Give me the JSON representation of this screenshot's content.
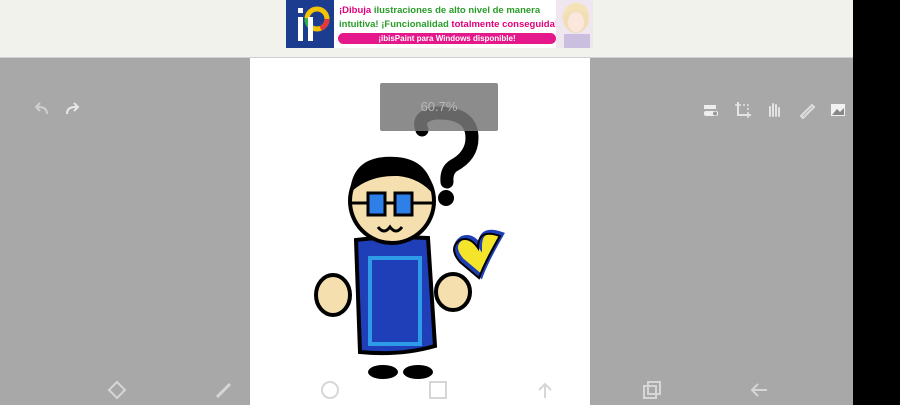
{
  "ad": {
    "logo_text": "iP",
    "headline_part1": "¡Dibuja",
    "headline_part2": " ilustraciones de alto nivel de manera",
    "line2_part1": "intuitiva! ¡Funcionalidad",
    "line2_part2": " totalmente conseguida!",
    "cta": "¡ibisPaint para Windows disponible!"
  },
  "zoom": {
    "label": "60.7%",
    "value_percent": 60.7
  },
  "toolbar_top": {
    "left": [
      {
        "name": "undo-icon"
      },
      {
        "name": "redo-icon"
      }
    ],
    "right": [
      {
        "name": "toggle-icon"
      },
      {
        "name": "crop-icon"
      },
      {
        "name": "hand-icon"
      },
      {
        "name": "pencil-icon"
      },
      {
        "name": "image-icon"
      }
    ]
  },
  "toolbar_bottom": [
    {
      "name": "transform-icon"
    },
    {
      "name": "brush-icon"
    },
    {
      "name": "circle-icon"
    },
    {
      "name": "square-icon"
    },
    {
      "name": "upload-icon"
    },
    {
      "name": "layers-icon"
    },
    {
      "name": "back-arrow-icon"
    }
  ],
  "colors": {
    "app_background": "#a8a8a8",
    "canvas": "#ffffff",
    "cape_blue": "#1f3fb8",
    "cape_light_blue": "#2e9be8",
    "skin": "#f5dfae",
    "heart_yellow": "#f5e52a"
  }
}
